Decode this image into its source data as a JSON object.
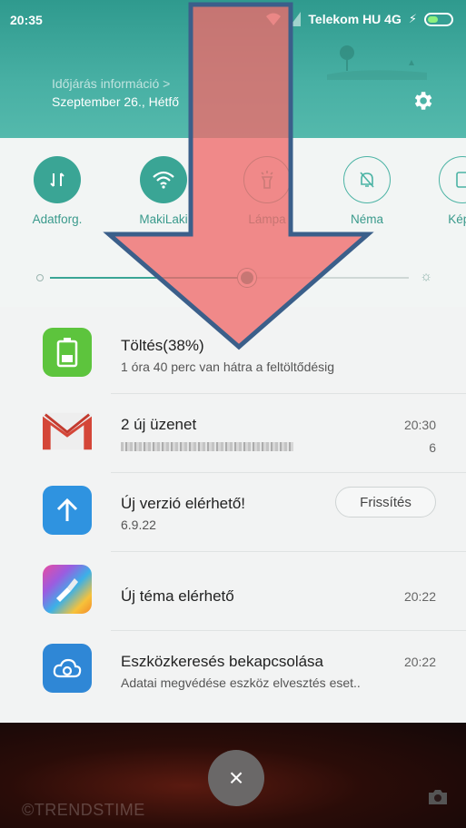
{
  "status_bar": {
    "time": "20:35",
    "carrier": "Telekom HU 4G",
    "charge_glyph": "⚡"
  },
  "header": {
    "weather_info": "Időjárás információ >",
    "date": "Szeptember 26., Hétfő"
  },
  "quick_toggles": [
    {
      "label": "Adatforg.",
      "icon": "data-transfer-icon",
      "state": "on"
    },
    {
      "label": "MakiLaki",
      "icon": "wifi-icon",
      "state": "on"
    },
    {
      "label": "Lámpa",
      "icon": "flashlight-icon",
      "state": "off"
    },
    {
      "label": "Néma",
      "icon": "silent-bell-icon",
      "state": "off"
    },
    {
      "label": "Képe",
      "icon": "screenshot-icon",
      "state": "off"
    }
  ],
  "brightness": {
    "level": 0.55
  },
  "notifications": [
    {
      "icon": "battery-icon",
      "title": "Töltés(38%)",
      "subtitle": "1 óra 40 perc  van hátra a feltöltődésig",
      "time": ""
    },
    {
      "icon": "gmail-icon",
      "title": "2 új üzenet",
      "subtitle": "",
      "time": "20:30",
      "count": "6"
    },
    {
      "icon": "update-arrow-icon",
      "title": "Új verzió elérhető!",
      "subtitle": "6.9.22",
      "button": "Frissítés"
    },
    {
      "icon": "theme-icon",
      "title": "Új téma elérhető",
      "time": "20:22"
    },
    {
      "icon": "cloud-icon",
      "title": "Eszközkeresés bekapcsolása",
      "subtitle": "Adatai megvédése eszköz elvesztés eset..",
      "time": "20:22"
    }
  ],
  "bottom": {
    "close_label": "×",
    "watermark": "©TRENDSTIME"
  },
  "colors": {
    "accent": "#3aa595",
    "header": "#48b0a4",
    "arrow": "#f06a6a",
    "arrow_border": "#3b5f8a"
  }
}
